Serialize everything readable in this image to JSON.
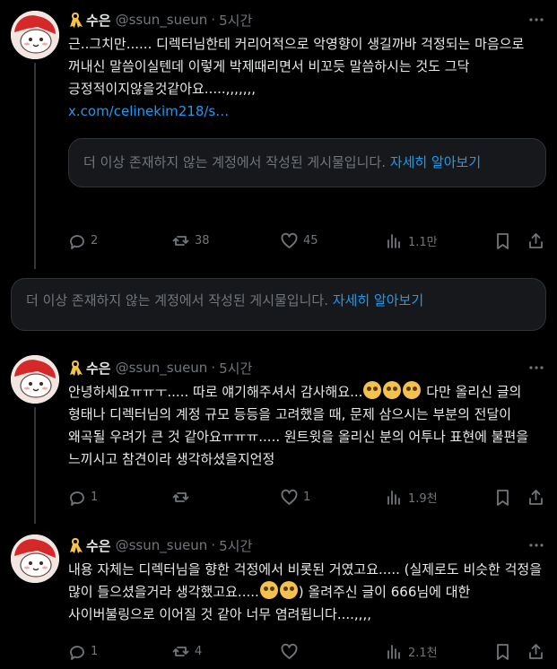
{
  "posts": [
    {
      "author": "수은",
      "handle": "@ssun_sueun",
      "dot": "·",
      "time": "5시간",
      "text": "근..그치만...... 디렉터님한테 커리어적으로 악영향이 생길까바 걱정되는 마음으로 꺼내신 말씀이실텐데 이렇게 박제때리면서 비꼬듯 말씀하시는 것도 그닥 긍정적이지않을것같아요.....,,,,,,,",
      "link": "x.com/celinekim218/s…",
      "quote_notice": "더 이상 존재하지 않는 계정에서 작성된 게시물입니다.",
      "quote_more": "자세히 알아보기",
      "replies": "2",
      "reposts": "38",
      "likes": "45",
      "views": "1.1만"
    },
    {
      "author": "수은",
      "handle": "@ssun_sueun",
      "dot": "·",
      "time": "5시간",
      "text_a": "안녕하세요ㅠㅠㅜ..... 따로 얘기해주셔서 감사해요...",
      "text_b": " 다만 올리신 글의 형태나 디렉터님의 계정 규모 등등을 고려했을 때, 문제 삼으시는 부분의 전달이 왜곡될 우려가 큰 것 같아요ㅠㅠㅠ..... 원트윗을 올리신 분의 어투나 표현에 불편을 느끼시고 참견이라 생각하셨을지언정",
      "replies": "1",
      "reposts": "",
      "likes": "1",
      "views": "1.9천"
    },
    {
      "author": "수은",
      "handle": "@ssun_sueun",
      "dot": "·",
      "time": "5시간",
      "text_a": "내용 자체는 디렉터님을 향한 걱정에서 비롯된 거였고요..... (실제로도 비슷한 걱정을 많이 들으셨을거라 생각했고요.....",
      "text_b": ") 올려주신 글이 666님에 대한 사이버불링으로 이어질 것 같아 너무 염려됩니다....,,,,",
      "replies": "1",
      "reposts": "4",
      "likes": "",
      "views": "2.1천"
    }
  ],
  "deleted_notice": {
    "text": "더 이상 존재하지 않는 계정에서 작성된 게시물입니다.",
    "more": "자세히 알아보기"
  },
  "colors": {
    "background": "#000000",
    "text": "#e7e9ea",
    "muted": "#71767b",
    "link": "#1d9bf0",
    "ribbon": "#f2c14e"
  }
}
